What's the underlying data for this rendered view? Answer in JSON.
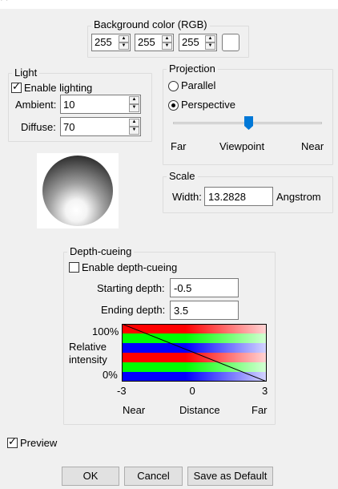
{
  "background": {
    "title": "Background color (RGB)",
    "r": "255",
    "g": "255",
    "b": "255",
    "swatch_color": "#ffffff"
  },
  "light": {
    "title": "Light",
    "enable_label": "Enable lighting",
    "enable_checked": true,
    "ambient_label": "Ambient:",
    "ambient_value": "10",
    "diffuse_label": "Diffuse:",
    "diffuse_value": "70"
  },
  "projection": {
    "title": "Projection",
    "parallel_label": "Parallel",
    "perspective_label": "Perspective",
    "selected": "perspective",
    "slider_level": 0.51,
    "far_label": "Far",
    "viewpoint_label": "Viewpoint",
    "near_label": "Near"
  },
  "scale": {
    "title": "Scale",
    "width_label": "Width:",
    "width_value": "13.2828",
    "unit": "Angstrom"
  },
  "depth_cueing": {
    "title": "Depth-cueing",
    "enable_label": "Enable depth-cueing",
    "enable_checked": false,
    "start_label": "Starting depth:",
    "start_value": "-0.5",
    "end_label": "Ending depth:",
    "end_value": "3.5",
    "y_top": "100%",
    "y_bottom": "0%",
    "y_label_1": "Relative",
    "y_label_2": "intensity",
    "x_ticks": [
      "-3",
      "0",
      "3"
    ],
    "x_near": "Near",
    "x_mid": "Distance",
    "x_far": "Far",
    "colors": [
      "#ff0000",
      "#00ff00",
      "#0000ff"
    ]
  },
  "preview": {
    "label": "Preview",
    "checked": true
  },
  "buttons": {
    "ok": "OK",
    "cancel": "Cancel",
    "save_default": "Save as Default"
  }
}
